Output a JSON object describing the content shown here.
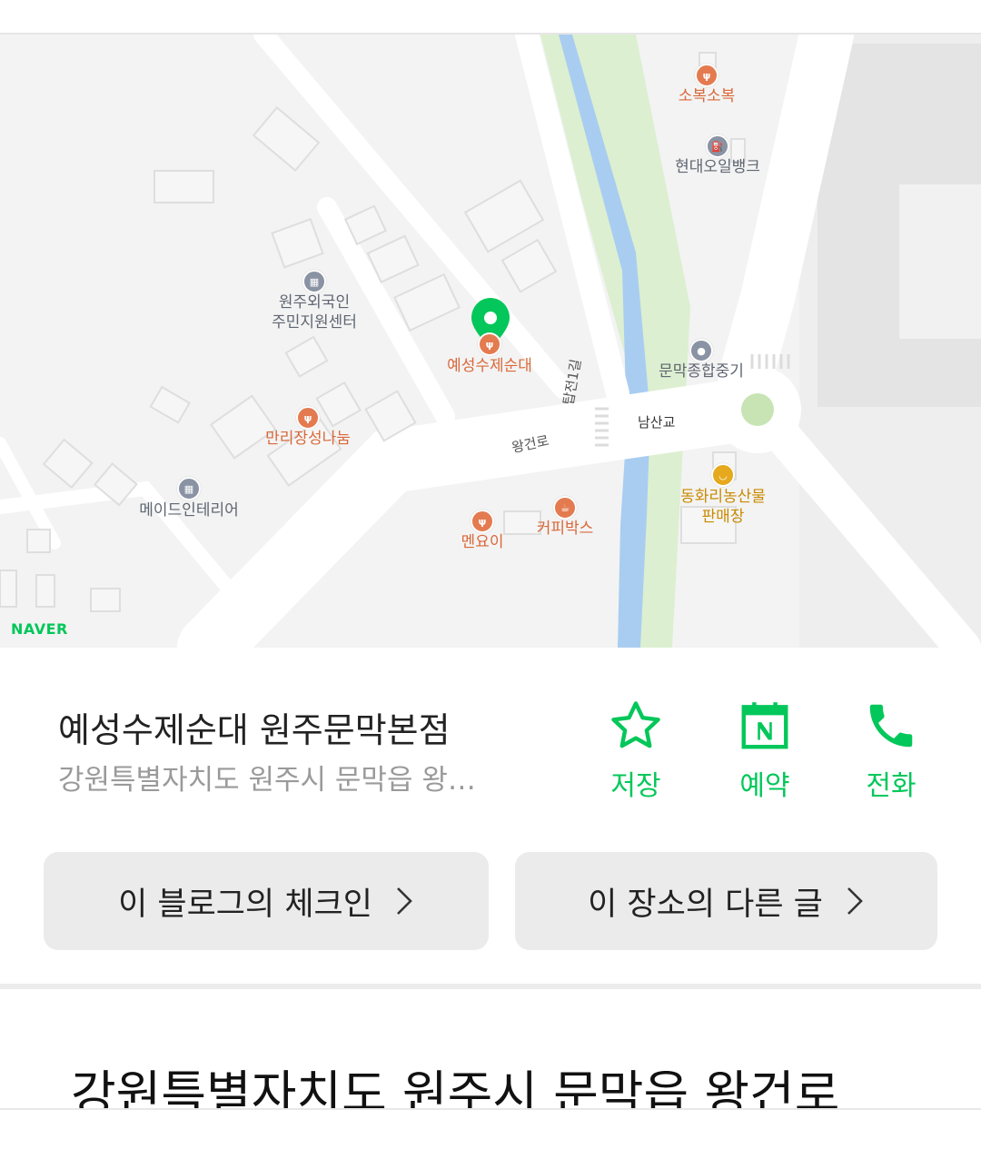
{
  "map": {
    "brand": "NAVER",
    "selected_place": "예성수제순대",
    "pois": [
      {
        "label": "소복소복",
        "kind": "food"
      },
      {
        "label": "현대오일뱅크",
        "kind": "gray"
      },
      {
        "label": "원주외국인\n주민지원센터",
        "kind": "gray"
      },
      {
        "label": "예성수제순대",
        "kind": "food"
      },
      {
        "label": "문막종합중기",
        "kind": "gray"
      },
      {
        "label": "만리장성나눔",
        "kind": "food"
      },
      {
        "label": "메이드인테리어",
        "kind": "gray"
      },
      {
        "label": "동화리농산물\n판매장",
        "kind": "shop"
      },
      {
        "label": "멘요이",
        "kind": "food"
      },
      {
        "label": "커피박스",
        "kind": "food"
      }
    ],
    "roads": {
      "road1": "왕건로",
      "road2": "탑전1길",
      "bridge": "남산교"
    },
    "colors": {
      "pin": "#03c75a",
      "water": "#a9cdf1",
      "park": "#dcefd0",
      "road": "#ffffff",
      "land": "#f3f3f3"
    }
  },
  "place": {
    "title": "예성수제순대 원주문막본점",
    "address": "강원특별자치도 원주시 문막읍 왕…"
  },
  "actions": [
    {
      "label": "저장",
      "icon": "star-icon"
    },
    {
      "label": "예약",
      "icon": "naver-booking-icon"
    },
    {
      "label": "전화",
      "icon": "phone-icon"
    }
  ],
  "links": {
    "checkin": "이 블로그의 체크인",
    "other_posts": "이 장소의 다른 글"
  },
  "body": {
    "address_heading": "강원특별자치도 원주시 문막읍 왕건로"
  }
}
